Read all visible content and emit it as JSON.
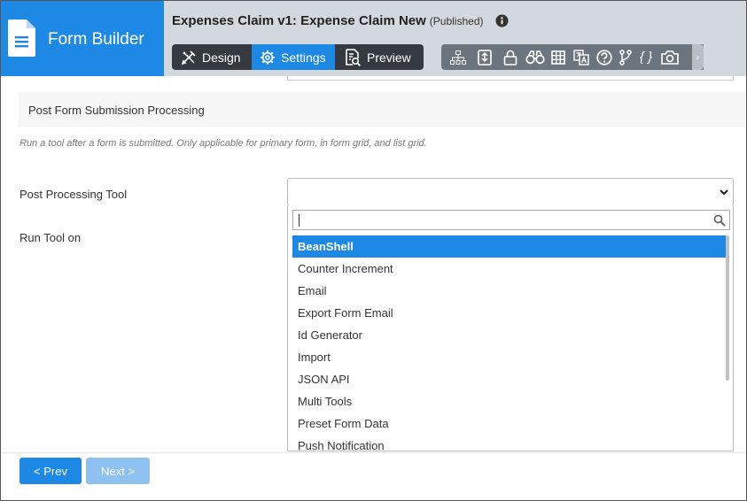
{
  "app": {
    "brand_title": "Form Builder",
    "form_title": "Expenses Claim v1: Expense Claim New",
    "form_status": "(Published)"
  },
  "modes": {
    "design_label": "Design",
    "settings_label": "Settings",
    "preview_label": "Preview",
    "active": "Settings"
  },
  "toolbar": {
    "icons": [
      "sitemap-icon",
      "form-import-icon",
      "lock-icon",
      "binoculars-icon",
      "grid-icon",
      "translate-icon",
      "help-icon",
      "branch-icon",
      "code-braces-icon",
      "camera-icon",
      "scroll-right-icon"
    ],
    "braces_text": "{ }",
    "scroll_glyph": "›"
  },
  "section": {
    "title": "Post Form Submission Processing",
    "description": "Run a tool after a form is submitted. Only applicable for primary form, in form grid, and list grid."
  },
  "fields": {
    "post_processing_tool_label": "Post Processing Tool",
    "run_tool_on_label": "Run Tool on",
    "search_value": ""
  },
  "dropdown": {
    "options": [
      "BeanShell",
      "Counter Increment",
      "Email",
      "Export Form Email",
      "Id Generator",
      "Import",
      "JSON API",
      "Multi Tools",
      "Preset Form Data",
      "Push Notification"
    ],
    "highlighted": "BeanShell"
  },
  "footer": {
    "prev_label": "< Prev",
    "next_label": "Next >"
  },
  "colors": {
    "brand_blue": "#1e88e5",
    "topbar_gray": "#d3d8df",
    "modebar_dark": "#343a40",
    "toolbar_gray": "#6c757d",
    "next_disabled": "#8ec1f0"
  }
}
